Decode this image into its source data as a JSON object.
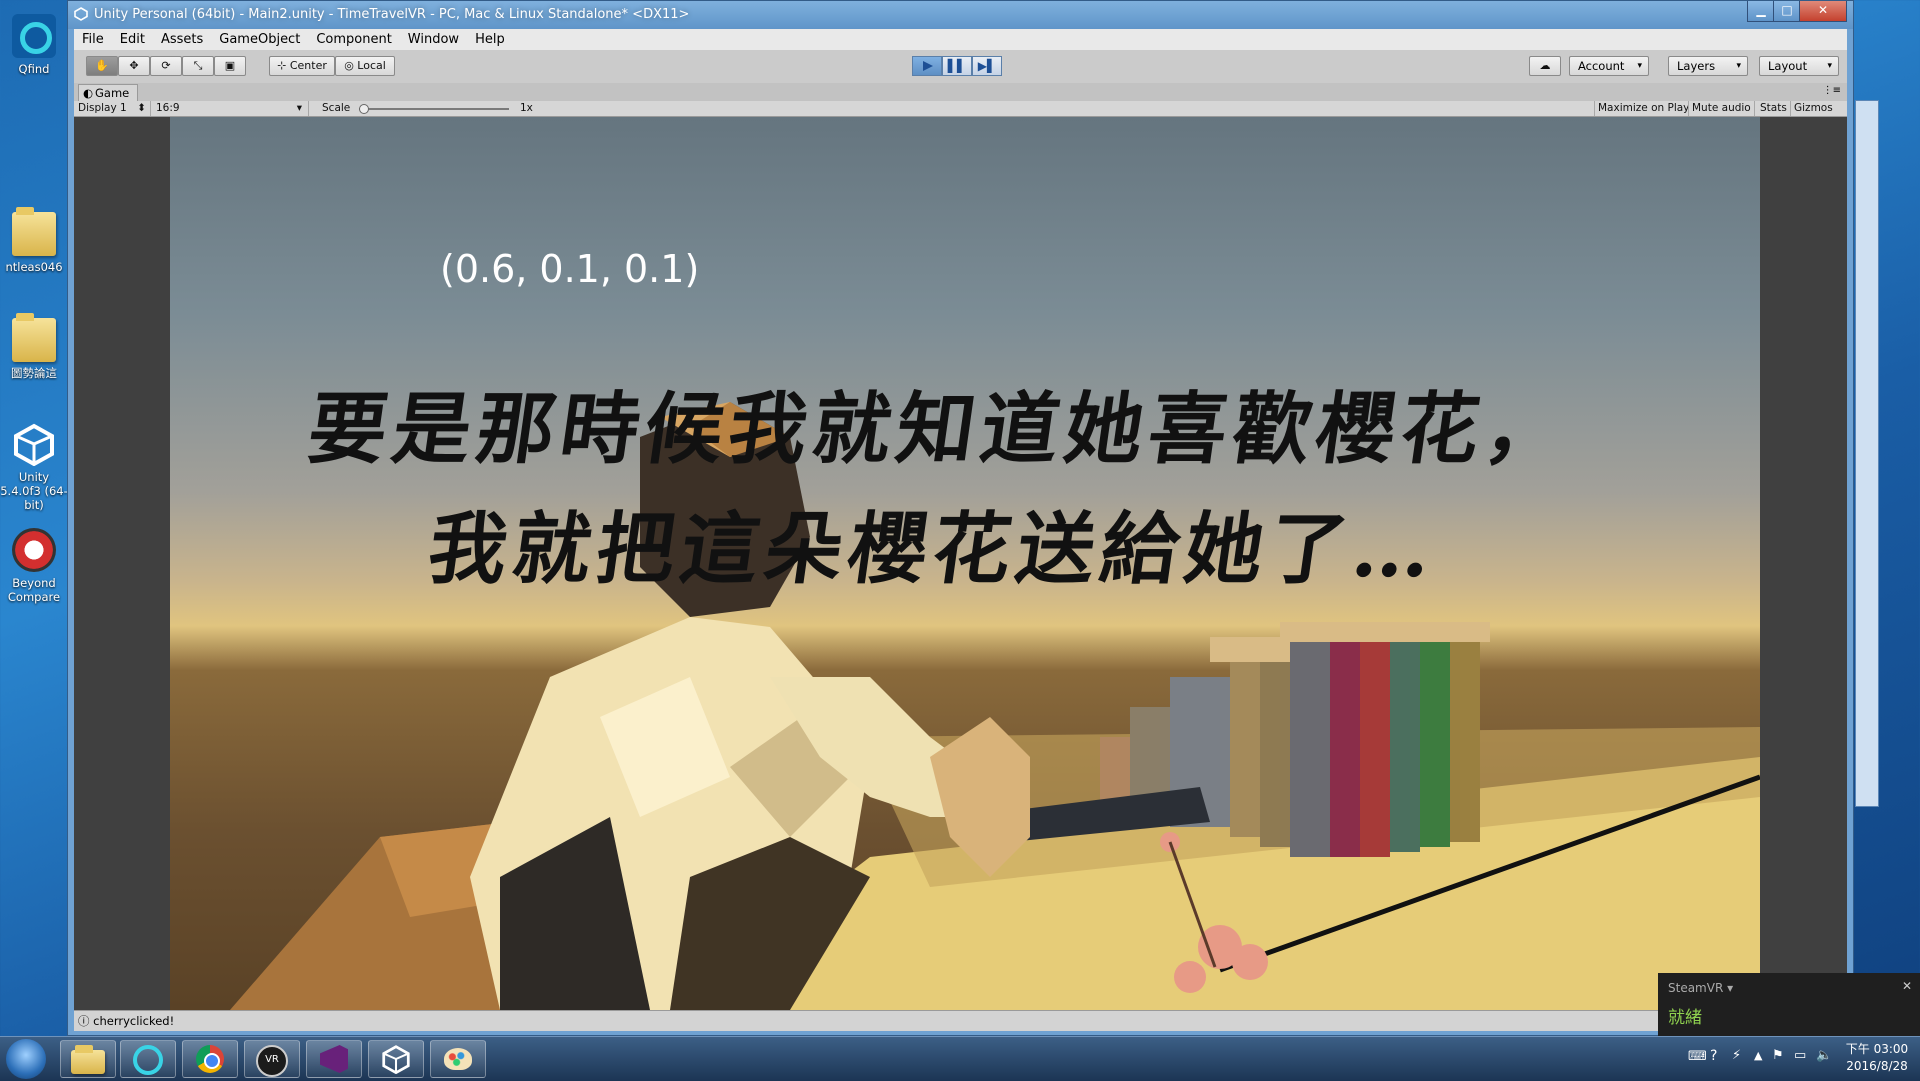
{
  "desktop": {
    "icons": [
      {
        "label": "Qfind",
        "icon": "qfind-icon"
      },
      {
        "label": "ntleas046",
        "icon": "folder-icon"
      },
      {
        "label": "圖勢論這",
        "icon": "folder-icon"
      },
      {
        "label": "Unity 5.4.0f3 (64-bit)",
        "icon": "unity-icon"
      },
      {
        "label": "Beyond Compare",
        "icon": "beyond-compare-icon"
      }
    ]
  },
  "window": {
    "title": "Unity Personal (64bit) - Main2.unity - TimeTravelVR - PC, Mac & Linux Standalone* <DX11>",
    "controls": {
      "minimize": "▁",
      "maximize": "□",
      "close": "✕"
    }
  },
  "menu": [
    "File",
    "Edit",
    "Assets",
    "GameObject",
    "Component",
    "Window",
    "Help"
  ],
  "toolbar": {
    "tools": [
      "hand-tool-icon",
      "move-tool-icon",
      "rotate-tool-icon",
      "scale-tool-icon",
      "rect-tool-icon"
    ],
    "pivot": "Center",
    "space": "Local",
    "account": "Account",
    "layers": "Layers",
    "layout": "Layout"
  },
  "game_view": {
    "tab": "Game",
    "display": "Display 1",
    "aspect": "16:9",
    "scale_label": "Scale",
    "scale_value": "1x",
    "buttons": [
      "Maximize on Play",
      "Mute audio",
      "Stats",
      "Gizmos"
    ],
    "coords": "(0.6, 0.1, 0.1)",
    "subtitle_line1": "要是那時候我就知道她喜歡櫻花，",
    "subtitle_line2": "我就把這朵櫻花送給她了…"
  },
  "status": {
    "message": "cherryclicked!"
  },
  "steamvr": {
    "title": "SteamVR ▾",
    "status": "就緒",
    "close": "✕"
  },
  "taskbar": {
    "apps": [
      "windows-start-icon",
      "explorer-icon",
      "search-app-icon",
      "chrome-icon",
      "vr-app-icon",
      "visual-studio-icon",
      "unity-taskbar-icon",
      "paint-icon"
    ],
    "time": "下午 03:00",
    "date": "2016/8/28"
  }
}
